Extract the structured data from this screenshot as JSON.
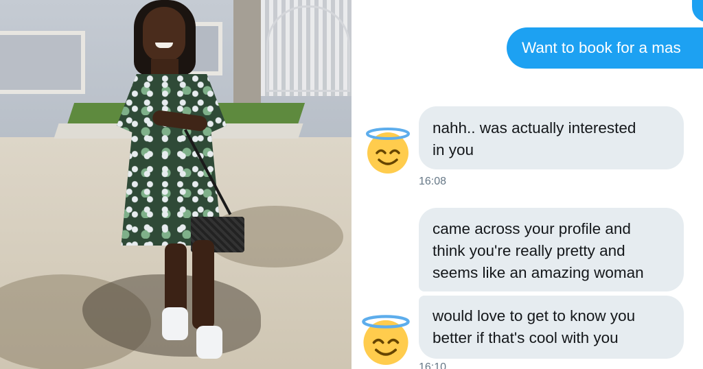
{
  "chat": {
    "messages": [
      {
        "id": "sent-1",
        "direction": "outgoing",
        "text": "Want to book for a mas"
      },
      {
        "id": "recv-1",
        "direction": "incoming",
        "lines": [
          "nahh.. was actually interested",
          "in you"
        ]
      },
      {
        "id": "recv-2",
        "direction": "incoming",
        "lines": [
          "came across your profile and",
          "think you're really pretty and",
          "seems like an amazing woman"
        ]
      },
      {
        "id": "recv-3",
        "direction": "incoming",
        "lines": [
          "would love to get to know you",
          "better if that's cool with you"
        ]
      }
    ],
    "timestamps": [
      "16:08",
      "16:10"
    ],
    "avatar_icon": "smiling-face-with-halo-icon"
  },
  "colors": {
    "outgoing_bubble": "#1da1f2",
    "incoming_bubble": "#e6ecf0",
    "timestamp": "#657786",
    "emoji_face": "#ffcc4d",
    "halo": "#5dadec"
  }
}
